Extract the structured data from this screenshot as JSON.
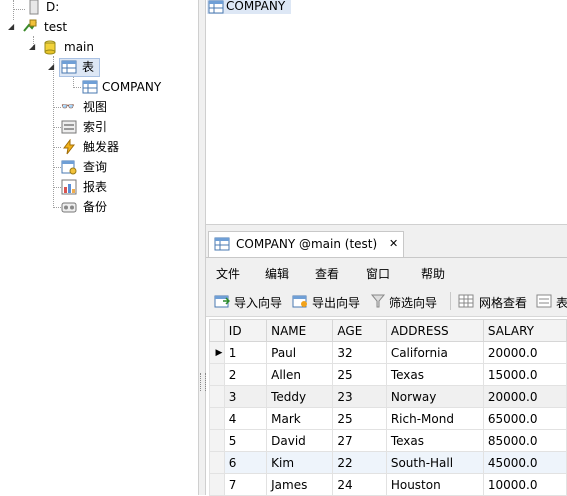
{
  "tree": {
    "root_label": "D:",
    "db_label": "test",
    "schema_label": "main",
    "tables_label": "表",
    "table_item": "COMPANY",
    "views_label": "视图",
    "indexes_label": "索引",
    "triggers_label": "触发器",
    "queries_label": "查询",
    "reports_label": "报表",
    "backup_label": "备份"
  },
  "objects": {
    "item": "COMPANY"
  },
  "tab": {
    "title": "COMPANY @main (test)",
    "close": "✕"
  },
  "menu": {
    "file": "文件",
    "edit": "编辑",
    "view": "查看",
    "window": "窗口",
    "help": "帮助"
  },
  "toolbar": {
    "import": "导入向导",
    "export": "导出向导",
    "filter": "筛选向导",
    "grid_view": "网格查看",
    "form_view": "表"
  },
  "grid": {
    "columns": [
      "ID",
      "NAME",
      "AGE",
      "ADDRESS",
      "SALARY"
    ],
    "rows": [
      [
        "1",
        "Paul",
        "32",
        "California",
        "20000.0"
      ],
      [
        "2",
        "Allen",
        "25",
        "Texas",
        "15000.0"
      ],
      [
        "3",
        "Teddy",
        "23",
        "Norway",
        "20000.0"
      ],
      [
        "4",
        "Mark",
        "25",
        "Rich-Mond",
        "65000.0"
      ],
      [
        "5",
        "David",
        "27",
        "Texas",
        "85000.0"
      ],
      [
        "6",
        "Kim",
        "22",
        "South-Hall",
        "45000.0"
      ],
      [
        "7",
        "James",
        "24",
        "Houston",
        "10000.0"
      ]
    ],
    "current_row_marker": "▶"
  },
  "colors": {
    "selection": "#dde7f5",
    "grid_border": "#e2e2e2",
    "panel_bg": "#f0f0f0"
  }
}
